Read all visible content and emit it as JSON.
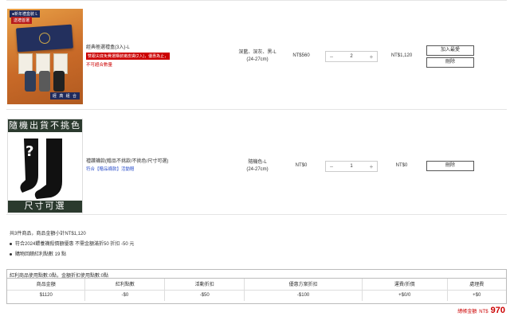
{
  "items": [
    {
      "thumb_badge_new": "●新年禮盒裝 L",
      "thumb_badge_red": "送禮首選",
      "thumb_tagline": "經 典 組 合",
      "name": "經典極選禮盒(3入)-L",
      "promo_red": "雙跟尖底免費選購裝嫩皮膚(2入)，優惠為止，",
      "promo_note": "不可超合數量",
      "spec_line1": "深藍、深灰、黑-L",
      "spec_line2": "(24-27cm)",
      "unit_price": "NT$560",
      "qty": "2",
      "subtotal": "NT$1,120",
      "actions": [
        "加入最愛",
        "刪除"
      ]
    },
    {
      "banner_top": "隨機出貨不挑色",
      "banner_bottom": "尺寸可選",
      "name": "禮讚襪款(贈品不挑款/不挑色/尺寸可選)",
      "promo_link": "符合【贈品襪款】活動贈",
      "spec_line1": "隨機色-L",
      "spec_line2": "(24-27cm)",
      "unit_price": "NT$0",
      "qty": "1",
      "subtotal": "NT$0",
      "actions": [
        "刪除"
      ]
    }
  ],
  "summary": {
    "count_line": "共3件商品，商品金額小計NT$1,120",
    "bullets": [
      "符合2024餵養襪殺價額優惠 不需金額滿折50 折扣 -50 元",
      "購物回饋紅利點數 19 點"
    ]
  },
  "calc": {
    "title": "紅利商品使用點數:0點，金額折扣使用點數:0點",
    "headers": [
      "商品金額",
      "紅利點數",
      "活動折扣",
      "優惠方案折扣",
      "運費/折價",
      "處理費"
    ],
    "values": [
      "$1120",
      "-$0",
      "-$50",
      "-$100",
      "+$0/0",
      "+$0"
    ]
  },
  "total": {
    "label": "總帳金額",
    "currency": "NT$",
    "amount": "970"
  },
  "icons": {
    "minus": "−",
    "plus": "+"
  }
}
